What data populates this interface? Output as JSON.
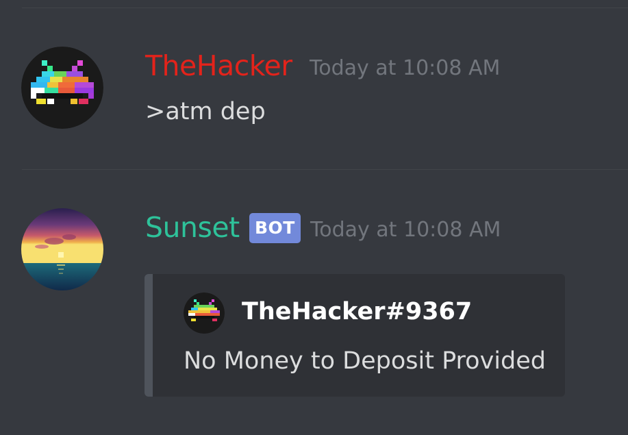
{
  "colors": {
    "background": "#36393f",
    "embed_background": "#2f3136",
    "embed_border": "#4f545c",
    "bot_badge": "#7289da",
    "timestamp": "#72767d",
    "message_text": "#dcddde"
  },
  "messages": [
    {
      "author": "TheHacker",
      "author_color": "#e3231b",
      "avatar_icon": "space-invader-icon",
      "timestamp": "Today at 10:08 AM",
      "content": ">atm dep"
    },
    {
      "author": "Sunset",
      "author_color": "#2ec29a",
      "avatar_icon": "sunset-icon",
      "badge": "BOT",
      "timestamp": "Today at 10:08 AM",
      "embed": {
        "author_icon": "space-invader-icon",
        "author_name": "TheHacker#9367",
        "description": "No Money to Deposit Provided"
      }
    }
  ]
}
